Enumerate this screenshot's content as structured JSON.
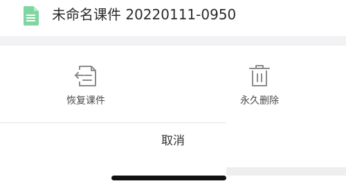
{
  "header": {
    "title": "未命名课件 20220111-0950",
    "file_icon": "document-icon",
    "file_icon_color": "#7ed6a0"
  },
  "actions": [
    {
      "label": "恢复课件",
      "icon": "restore-icon"
    },
    {
      "label": "永久删除",
      "icon": "trash-icon"
    }
  ],
  "cancel": {
    "label": "取消"
  },
  "colors": {
    "icon_gray": "#8a8a8a",
    "band": "#f2f2f4",
    "text": "#2a2a2a"
  }
}
